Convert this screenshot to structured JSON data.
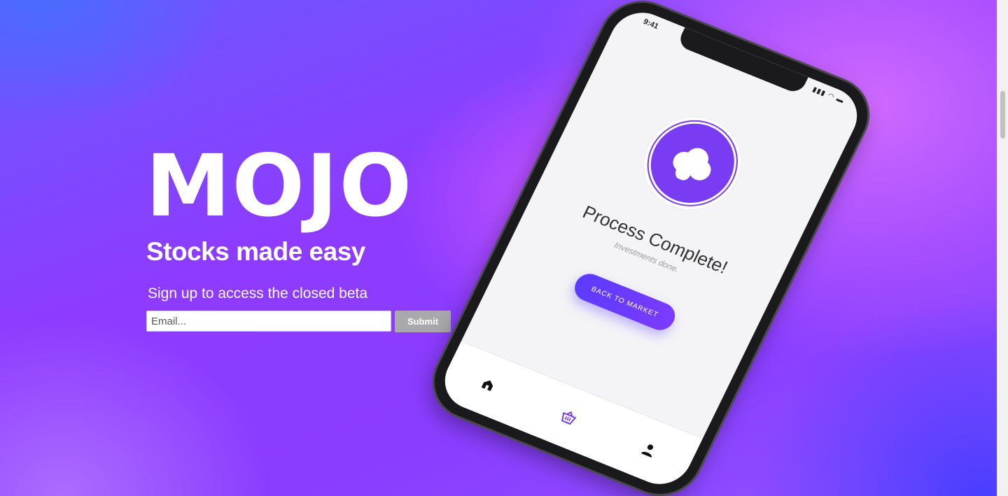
{
  "brand": {
    "logo_text": "MOJO",
    "tagline": "Stocks made easy"
  },
  "signup": {
    "subtitle": "Sign up to access the closed beta",
    "email_placeholder": "Email...",
    "submit_label": "Submit"
  },
  "phone": {
    "status_time": "9:41",
    "title": "Process Complete!",
    "subtitle": "Investments done.",
    "button_label": "BACK TO MARKET",
    "tabs": [
      {
        "icon": "home-icon"
      },
      {
        "icon": "basket-icon"
      },
      {
        "icon": "user-icon"
      }
    ]
  },
  "colors": {
    "accent": "#7a3cf2",
    "button_gradient_start": "#5b3bff",
    "submit_bg": "#a9a9ad"
  }
}
